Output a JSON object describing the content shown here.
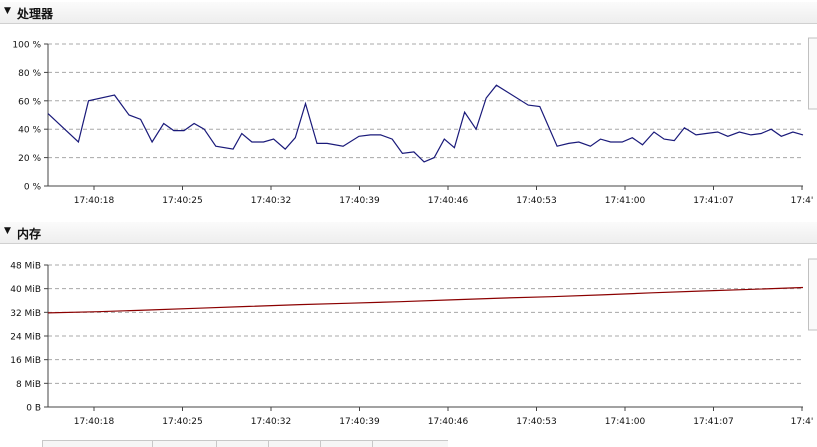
{
  "cpu_panel": {
    "title": "处理器",
    "toggle_icon": "triangle-down-icon"
  },
  "memory_panel": {
    "title": "内存",
    "toggle_icon": "triangle-down-icon"
  },
  "chart_data": [
    {
      "type": "line",
      "title": "处理器",
      "xlabel": "",
      "ylabel": "",
      "ylim": [
        0,
        100
      ],
      "yticks": [
        "100 %",
        "80 %",
        "60 %",
        "40 %",
        "20 %",
        "0 %"
      ],
      "xticks": [
        "17:40:18",
        "17:40:25",
        "17:40:32",
        "17:40:39",
        "17:40:46",
        "17:40:53",
        "17:41:00",
        "17:41:07",
        "17:4'"
      ],
      "grid": true,
      "series": [
        {
          "color": "#1a1a7a",
          "x": [
            0,
            2.1,
            2.8,
            4.6,
            5.6,
            6.4,
            7.2,
            8.0,
            8.7,
            9.4,
            10.1,
            10.8,
            11.6,
            12.8,
            13.4,
            14.1,
            14.9,
            15.6,
            16.4,
            17.1,
            17.8,
            18.6,
            19.3,
            20.4,
            21.5,
            22.3,
            23.0,
            23.8,
            24.5,
            25.3,
            26.0,
            26.7,
            27.4,
            28.1,
            28.8,
            29.6,
            30.3,
            31.0,
            33.2,
            34.0,
            35.2,
            36.0,
            36.7,
            37.5,
            38.2,
            38.9,
            39.7,
            40.4,
            41.1,
            41.9,
            42.6,
            43.3,
            44.0,
            44.8,
            45.5,
            46.3,
            47.0,
            47.8,
            48.6,
            49.3,
            50.0,
            50.7,
            51.5,
            52.2
          ],
          "values": [
            51,
            31,
            60,
            64,
            50,
            47,
            31,
            44,
            39,
            39,
            44,
            40,
            28,
            26,
            37,
            31,
            31,
            33,
            26,
            34,
            58,
            30,
            30,
            28,
            35,
            36,
            36,
            33,
            23,
            24,
            17,
            20,
            33,
            27,
            52,
            40,
            62,
            71,
            57,
            56,
            28,
            30,
            31,
            28,
            33,
            31,
            31,
            34,
            29,
            38,
            33,
            32,
            41,
            36,
            37,
            38,
            35,
            38,
            36,
            37,
            40,
            35,
            38,
            36
          ]
        }
      ]
    },
    {
      "type": "line",
      "title": "内存",
      "xlabel": "",
      "ylabel": "",
      "ylim": [
        0,
        48
      ],
      "yticks": [
        "48 MiB",
        "40 MiB",
        "32 MiB",
        "24 MiB",
        "16 MiB",
        "8 MiB",
        "0 B"
      ],
      "xticks": [
        "17:40:18",
        "17:40:25",
        "17:40:32",
        "17:40:39",
        "17:40:46",
        "17:40:53",
        "17:41:00",
        "17:41:07",
        "17:4'"
      ],
      "grid": true,
      "series": [
        {
          "color": "#8b0000",
          "x": [
            0,
            4,
            8,
            12,
            16,
            20,
            24,
            28,
            32,
            36,
            40,
            44,
            48,
            52,
            56,
            60
          ],
          "values": [
            31.8,
            32.2,
            32.8,
            33.4,
            34.0,
            34.6,
            35.1,
            35.6,
            36.2,
            36.8,
            37.3,
            37.9,
            38.6,
            39.2,
            39.8,
            40.4
          ]
        }
      ]
    }
  ]
}
